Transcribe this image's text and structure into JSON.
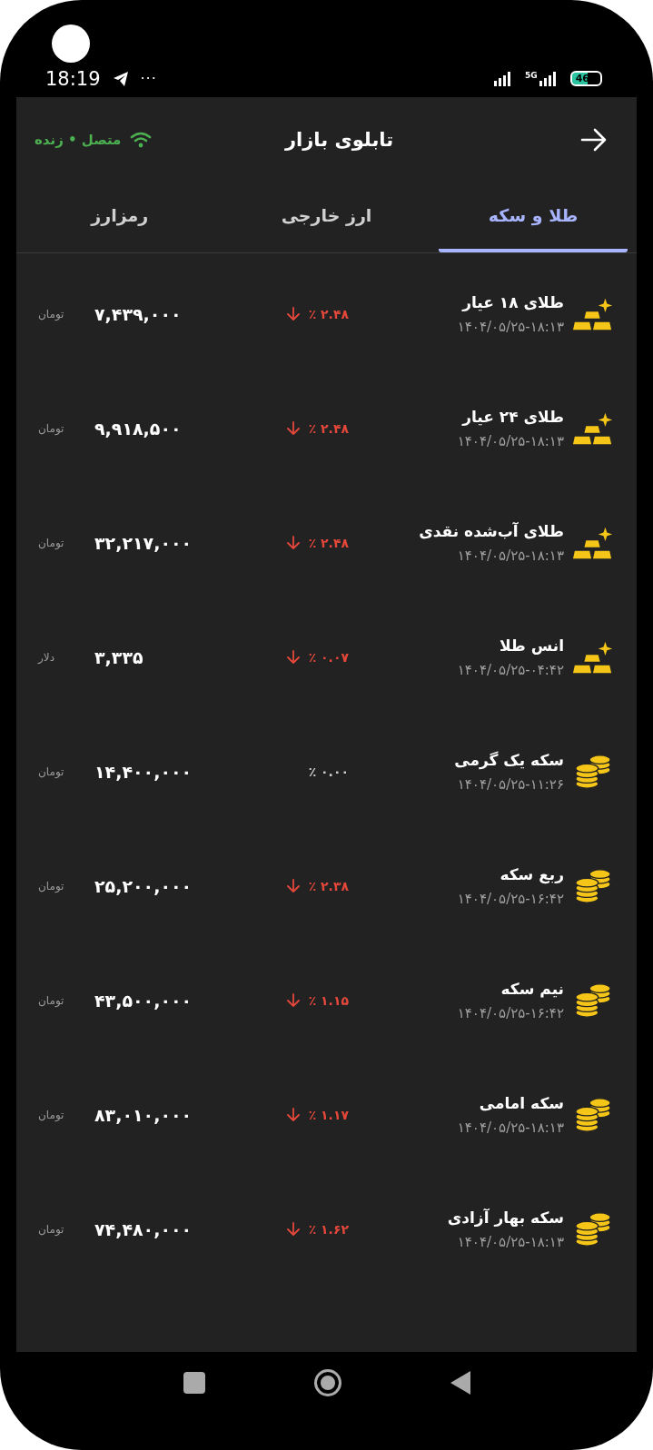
{
  "status_bar": {
    "time": "18:19",
    "more": "···",
    "network": "5G",
    "battery": "46"
  },
  "header": {
    "title": "تابلوی بازار",
    "connection": "متصل • زنده"
  },
  "tabs": [
    {
      "label": "طلا و سکه",
      "selected": true
    },
    {
      "label": "ارز خارجی",
      "selected": false
    },
    {
      "label": "رمزارز",
      "selected": false
    }
  ],
  "rows": [
    {
      "kind": "bar",
      "name": "طلای ۱۸ عیار",
      "time": "۱۴۰۴/۰۵/۲۵-۱۸:۱۳",
      "falling": true,
      "change": "٪ ۲.۴۸",
      "price": "۷,۴۳۹,۰۰۰",
      "unit": "تومان"
    },
    {
      "kind": "bar",
      "name": "طلای ۲۴ عیار",
      "time": "۱۴۰۴/۰۵/۲۵-۱۸:۱۳",
      "falling": true,
      "change": "٪ ۲.۴۸",
      "price": "۹,۹۱۸,۵۰۰",
      "unit": "تومان"
    },
    {
      "kind": "bar",
      "name": "طلای آب‌شده نقدی",
      "time": "۱۴۰۴/۰۵/۲۵-۱۸:۱۳",
      "falling": true,
      "change": "٪ ۲.۴۸",
      "price": "۳۲,۲۱۷,۰۰۰",
      "unit": "تومان"
    },
    {
      "kind": "bar",
      "name": "انس طلا",
      "time": "۱۴۰۴/۰۵/۲۵-۰۴:۴۲",
      "falling": true,
      "change": "٪ ۰.۰۷",
      "price": "۳,۳۳۵",
      "unit": "دلار"
    },
    {
      "kind": "coin",
      "name": "سکه یک گرمی",
      "time": "۱۴۰۴/۰۵/۲۵-۱۱:۲۶",
      "falling": false,
      "change": "٪ ۰.۰۰",
      "price": "۱۴,۴۰۰,۰۰۰",
      "unit": "تومان"
    },
    {
      "kind": "coin",
      "name": "ربع سکه",
      "time": "۱۴۰۴/۰۵/۲۵-۱۶:۴۲",
      "falling": true,
      "change": "٪ ۲.۳۸",
      "price": "۲۵,۲۰۰,۰۰۰",
      "unit": "تومان"
    },
    {
      "kind": "coin",
      "name": "نیم سکه",
      "time": "۱۴۰۴/۰۵/۲۵-۱۶:۴۲",
      "falling": true,
      "change": "٪ ۱.۱۵",
      "price": "۴۳,۵۰۰,۰۰۰",
      "unit": "تومان"
    },
    {
      "kind": "coin",
      "name": "سکه امامی",
      "time": "۱۴۰۴/۰۵/۲۵-۱۸:۱۳",
      "falling": true,
      "change": "٪ ۱.۱۷",
      "price": "۸۳,۰۱۰,۰۰۰",
      "unit": "تومان"
    },
    {
      "kind": "coin",
      "name": "سکه بهار آزادی",
      "time": "۱۴۰۴/۰۵/۲۵-۱۸:۱۳",
      "falling": true,
      "change": "٪ ۱.۶۲",
      "price": "۷۴,۴۸۰,۰۰۰",
      "unit": "تومان"
    }
  ]
}
